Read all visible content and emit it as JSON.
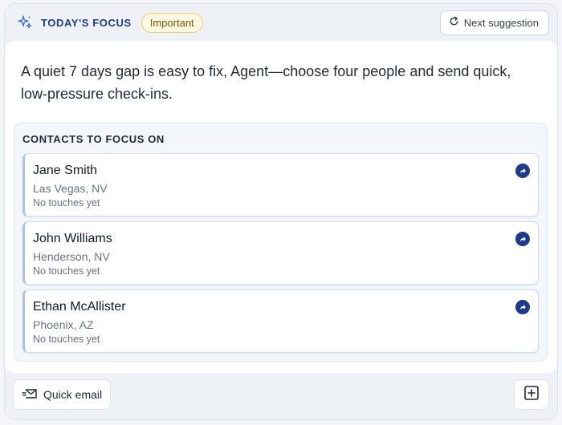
{
  "header": {
    "icon": "sparkle-icon",
    "title": "TODAY'S FOCUS",
    "badge": "Important",
    "next_label": "Next suggestion"
  },
  "message": "A quiet 7 days gap is easy to fix, Agent—choose four people and send quick, low-pressure check-ins.",
  "contacts": {
    "heading": "CONTACTS TO FOCUS ON",
    "items": [
      {
        "name": "Jane Smith",
        "location": "Las Vegas, NV",
        "touches": "No touches yet"
      },
      {
        "name": "John Williams",
        "location": "Henderson, NV",
        "touches": "No touches yet"
      },
      {
        "name": "Ethan McAllister",
        "location": "Phoenix, AZ",
        "touches": "No touches yet"
      }
    ]
  },
  "footer": {
    "quick_email_label": "Quick email",
    "quick_email_icon": "mail-send-icon",
    "add_icon": "plus-square-icon"
  },
  "colors": {
    "accent": "#1e3a8a",
    "badge_bg": "#fff7e0",
    "badge_border": "#f1cf78"
  }
}
